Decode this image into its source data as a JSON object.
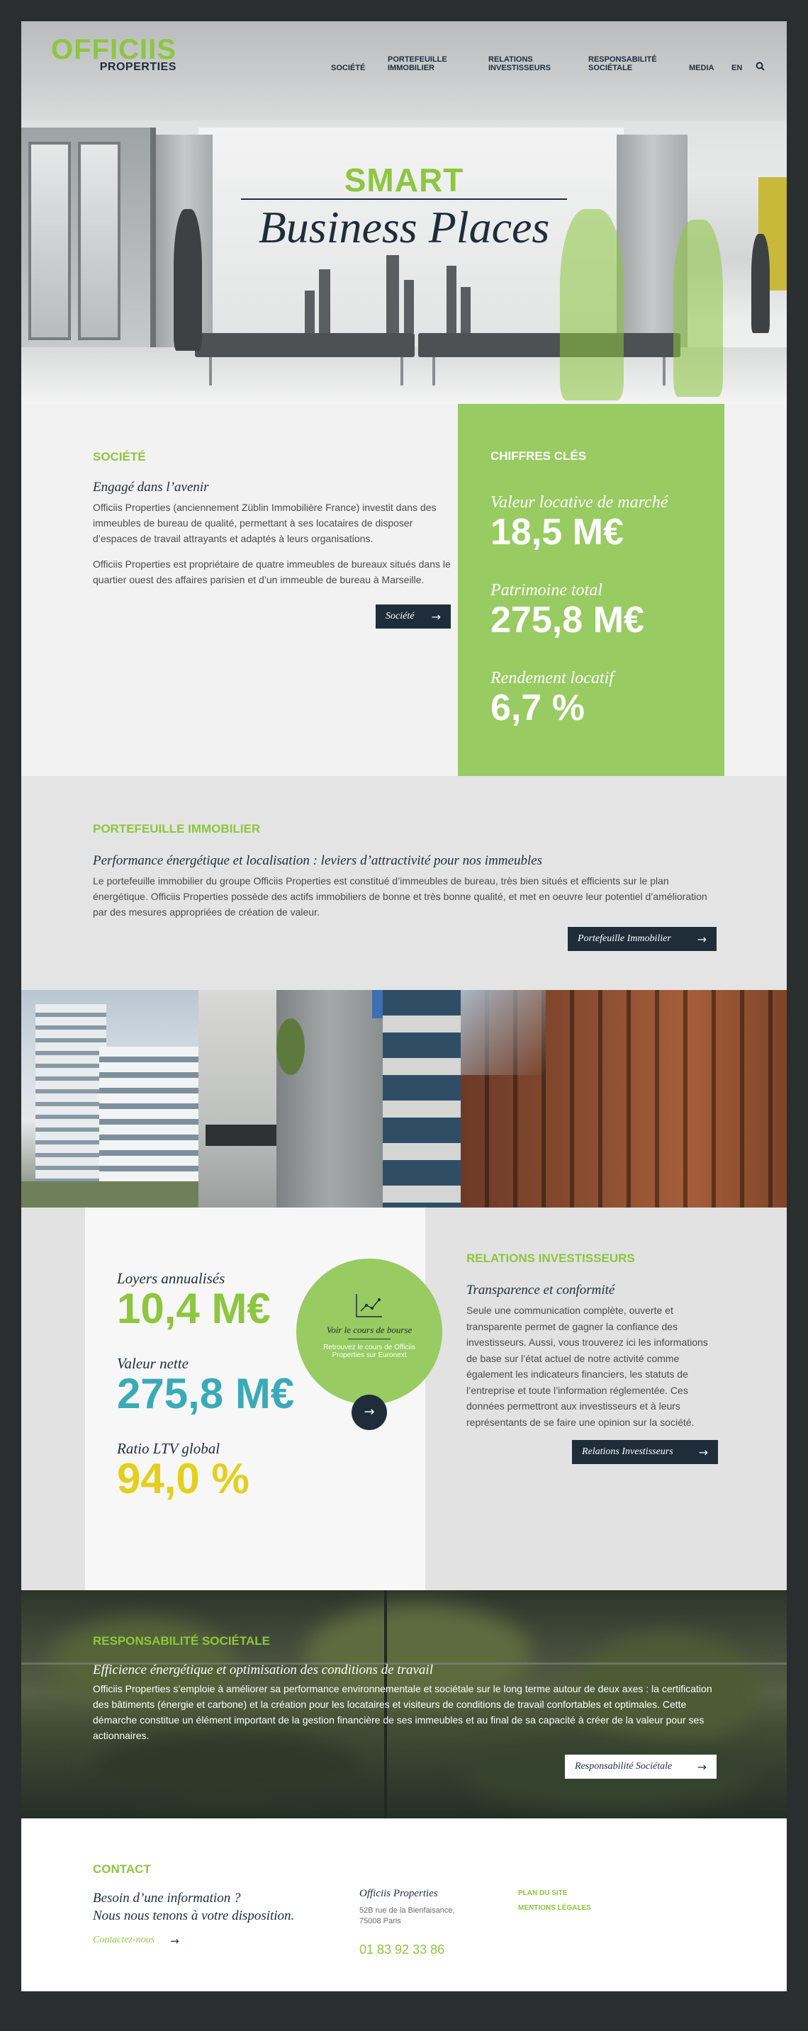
{
  "brand": {
    "line1": "OFFICIIS",
    "line2": "PROPERTIES"
  },
  "nav": {
    "items": [
      {
        "label": "SOCIÉTÉ"
      },
      {
        "label": "PORTEFEUILLE IMMOBILIER"
      },
      {
        "label": "RELATIONS INVESTISSEURS"
      },
      {
        "label": "RESPONSABILITÉ SOCIÉTALE"
      },
      {
        "label": "MEDIA"
      },
      {
        "label": "EN"
      }
    ],
    "search_icon": "search-icon"
  },
  "hero": {
    "title_top": "SMART",
    "title_main": "Business Places"
  },
  "societe": {
    "heading": "SOCIÉTÉ",
    "subtitle": "Engagé dans l’avenir",
    "p1": "Officiis Properties (anciennement Züblin Immobilière France) investit dans des immeubles de bureau de qualité, permettant à ses locataires de disposer d’espaces de travail attrayants et adaptés à leurs organisations.",
    "p2": "Officiis Properties est propriétaire de quatre immeubles de bureaux situés dans le quartier ouest des affaires parisien et d’un immeuble de bureau à Marseille.",
    "button": "Société"
  },
  "chiffres": {
    "heading": "CHIFFRES CLÉS",
    "items": [
      {
        "label": "Valeur locative de marché",
        "value": "18,5 M€"
      },
      {
        "label": "Patrimoine total",
        "value": "275,8 M€"
      },
      {
        "label": "Rendement locatif",
        "value": "6,7 %"
      }
    ]
  },
  "portefeuille": {
    "heading": "PORTEFEUILLE IMMOBILIER",
    "subtitle": "Performance énergétique et localisation : leviers d’attractivité pour nos immeubles",
    "body": "Le portefeuille immobilier du groupe Officiis Properties est constitué d’immeubles de bureau, très bien situés et efficients sur le plan énergétique. Officiis Properties possède des actifs immobiliers de bonne et très bonne qualité, et met en oeuvre leur potentiel d’amélioration par des mesures appropriées de création de valeur.",
    "button": "Portefeuille Immobilier"
  },
  "investisseurs": {
    "stats": [
      {
        "label": "Loyers annualisés",
        "value": "10,4 M€",
        "color": "#8dc63f"
      },
      {
        "label": "Valeur nette",
        "value": "275,8 M€",
        "color": "#3aaab8"
      },
      {
        "label": "Ratio LTV global",
        "value": "94,0 %",
        "color": "#e5cf1c"
      }
    ],
    "bourse": {
      "title": "Voir le cours de bourse",
      "text": "Retrouvez le cours de Officiis Properties sur Euronext"
    },
    "heading": "RELATIONS INVESTISSEURS",
    "subtitle": "Transparence et conformité",
    "body": "Seule une communication complète, ouverte et transparente permet de gagner la confiance des investisseurs. Aussi, vous trouverez ici les informations de base sur l’état actuel de notre activité comme également les indicateurs financiers, les statuts de l’entreprise et toute l’information réglementée. Ces données permettront aux investisseurs et à leurs représentants de se faire une opinion sur la société.",
    "button": "Relations Investisseurs"
  },
  "responsabilite": {
    "heading": "RESPONSABILITÉ SOCIÉTALE",
    "subtitle": "Efficience énergétique et optimisation des conditions de travail",
    "body": "Officiis Properties s’emploie à améliorer sa performance environnementale et sociétale sur le long terme autour de deux axes : la certification des bâtiments (énergie et carbone) et la création pour les locataires et visiteurs de conditions de travail confortables et optimales. Cette démarche constitue un élément important de la gestion financière de ses immeubles et au final de sa capacité à créer de la valeur pour ses actionnaires.",
    "button": "Responsabilité Sociétale"
  },
  "contact": {
    "heading": "CONTACT",
    "line1": "Besoin d’une information ?",
    "line2": "Nous nous tenons à votre disposition.",
    "link": "Contactez-nous",
    "company": "Officiis Properties",
    "address1": "52B rue de la Bienfaisance,",
    "address2": "75008 Paris",
    "phone": "01 83 92 33 86",
    "links": [
      "PLAN DU SITE",
      "MENTIONS LÉGALES"
    ]
  },
  "colors": {
    "green": "#8dc63f",
    "navy": "#1f2d3a",
    "teal": "#3aaab8",
    "yellow": "#e5cf1c"
  }
}
